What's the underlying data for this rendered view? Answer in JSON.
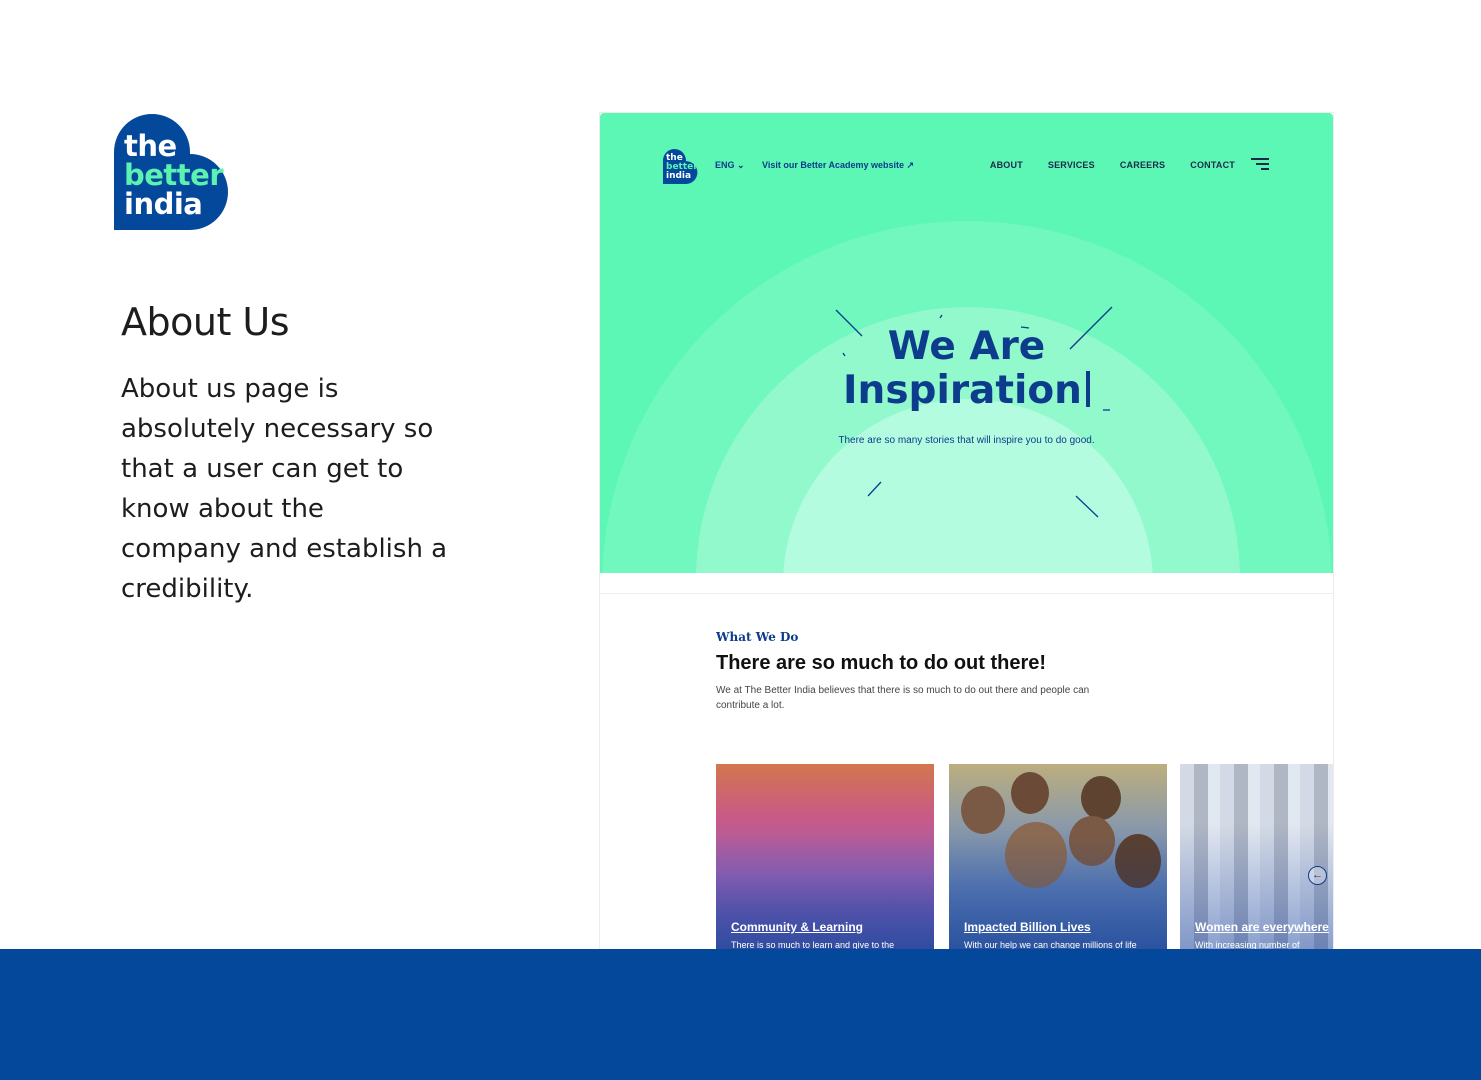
{
  "brand": {
    "logo_lines": [
      "the",
      "better",
      "india"
    ],
    "colors": {
      "primary": "#03489a",
      "accent": "#5cf3b0",
      "hero": "#5cf7b5"
    }
  },
  "about": {
    "title": "About Us",
    "description": "About us page is absolutely necessary so that a user can get to know about the company and establish a credibility."
  },
  "site": {
    "nav": {
      "logo_lines": [
        "the",
        "better",
        "india"
      ],
      "lang": "ENG",
      "lang_icon": "chevron-down-icon",
      "academy_link": "Visit our Better Academy website ↗",
      "links": [
        "ABOUT",
        "SERVICES",
        "CAREERS",
        "CONTACT"
      ],
      "menu_icon": "hamburger-menu-icon"
    },
    "hero": {
      "title_line1": "We Are",
      "title_line2": "Inspiration",
      "subtitle": "There are so many stories that will inspire you to do good."
    },
    "what_we_do": {
      "label": "What We Do",
      "title": "There are so much to do out there!",
      "description": "We at The Better India believes that there is so much to do out there and people can contribute a lot."
    },
    "cards": [
      {
        "title": "Community & Learning",
        "subtitle": "There is so much to learn and give to the"
      },
      {
        "title": "Impacted Billion Lives",
        "subtitle": "With our help we can change millions of life"
      },
      {
        "title": "Women are everywhere",
        "subtitle": "With increasing number of"
      }
    ],
    "carousel_icon": "arrow-left-circle-icon"
  }
}
